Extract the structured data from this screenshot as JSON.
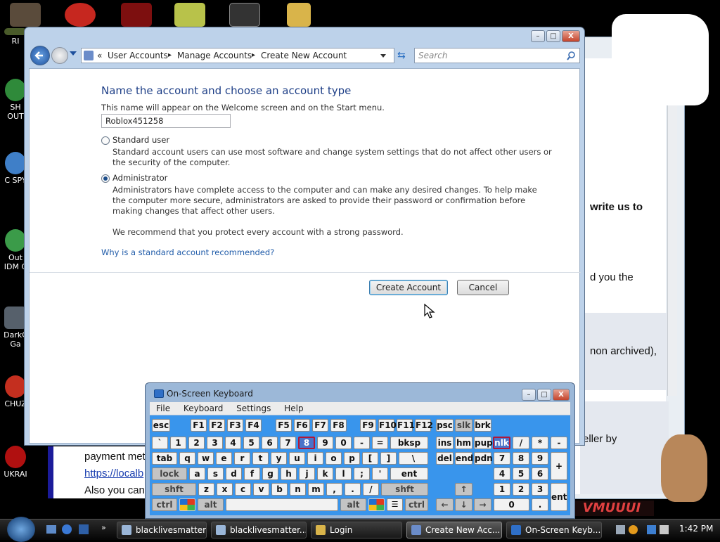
{
  "desktop": {
    "icons": [
      {
        "label": "RI",
        "color": "#4a5b2a"
      },
      {
        "label": "SH OUT",
        "color": "#2f8a3a"
      },
      {
        "label": "C SPY",
        "color": "#3f7fc8"
      },
      {
        "label": "Out IDM C",
        "color": "#3b9b49"
      },
      {
        "label": "DarkC Ga",
        "color": "#56606b"
      },
      {
        "label": "CHUZ",
        "color": "#c42f1f"
      },
      {
        "label": "UKRAI",
        "color": "#b01010"
      }
    ]
  },
  "background_window": {
    "texts": [
      "write us to",
      "d you the",
      "non archived),",
      "eller by",
      "payment met",
      "https://localb",
      "Also you can",
      "VMUUUI"
    ]
  },
  "dialog": {
    "title_buttons": {
      "minimize": "–",
      "maximize": "□",
      "close": "X"
    },
    "breadcrumb": [
      "«",
      "User Accounts",
      "▸",
      "Manage Accounts",
      "▸",
      "Create New Account"
    ],
    "search_placeholder": "Search",
    "heading": "Name the account and choose an account type",
    "hint": "This name will appear on the Welcome screen and on the Start menu.",
    "name_value": "Roblox451258",
    "standard": {
      "label": "Standard user",
      "desc1": "Standard account users can use most software and change system settings that do not affect other users or",
      "desc2": "the security of the computer.",
      "selected": false
    },
    "admin": {
      "label": "Administrator",
      "desc1": "Administrators have complete access to the computer and can make any desired changes. To help make",
      "desc2": "the computer more secure, administrators are asked to provide their password or confirmation before",
      "desc3": "making changes that affect other users.",
      "selected": true
    },
    "recommend": "We recommend that you protect every account with a strong password.",
    "help_link": "Why is a standard account recommended?",
    "create_label": "Create Account",
    "cancel_label": "Cancel"
  },
  "osk": {
    "title": "On-Screen Keyboard",
    "menu": [
      "File",
      "Keyboard",
      "Settings",
      "Help"
    ],
    "keys": {
      "esc": "esc",
      "f1": "F1",
      "f2": "F2",
      "f3": "F3",
      "f4": "F4",
      "f5": "F5",
      "f6": "F6",
      "f7": "F7",
      "f8": "F8",
      "f9": "F9",
      "f10": "F10",
      "f11": "F11",
      "f12": "F12",
      "psc": "psc",
      "slk": "slk",
      "brk": "brk",
      "grave": "`",
      "n1": "1",
      "n2": "2",
      "n3": "3",
      "n4": "4",
      "n5": "5",
      "n6": "6",
      "n7": "7",
      "n8": "8",
      "n9": "9",
      "n0": "0",
      "minus": "-",
      "equals": "=",
      "bksp": "bksp",
      "ins": "ins",
      "hm": "hm",
      "pup": "pup",
      "nlk": "nlk",
      "kdiv": "/",
      "kmul": "*",
      "kminus": "-",
      "tab": "tab",
      "q": "q",
      "w": "w",
      "e": "e",
      "r": "r",
      "t": "t",
      "y": "y",
      "u": "u",
      "i": "i",
      "o": "o",
      "p": "p",
      "lbr": "[",
      "rbr": "]",
      "bslash": "\\",
      "del": "del",
      "end": "end",
      "pdn": "pdn",
      "k7": "7",
      "k8": "8",
      "k9": "9",
      "kplus": "+",
      "lock": "lock",
      "a": "a",
      "s": "s",
      "d": "d",
      "f": "f",
      "g": "g",
      "h": "h",
      "j": "j",
      "k": "k",
      "l": "l",
      "semi": ";",
      "quote": "'",
      "ent": "ent",
      "k4": "4",
      "k5": "5",
      "k6": "6",
      "shft": "shft",
      "z": "z",
      "x": "x",
      "c": "c",
      "v": "v",
      "b": "b",
      "n": "n",
      "m": "m",
      "comma": ",",
      "period": ".",
      "slash": "/",
      "shft2": "shft",
      "up": "↑",
      "k1": "1",
      "k2": "2",
      "k3": "3",
      "kent": "ent",
      "ctrl": "ctrl",
      "alt": "alt",
      "alt2": "alt",
      "ctrl2": "ctrl",
      "left": "←",
      "down": "↓",
      "right": "→",
      "k0": "0",
      "kdot": "."
    }
  },
  "taskbar": {
    "tasks": [
      "blacklivesmatter...",
      "blacklivesmatter...",
      "Login",
      "Create New Acc...",
      "On-Screen Keyb..."
    ],
    "clock": "1:42 PM"
  }
}
